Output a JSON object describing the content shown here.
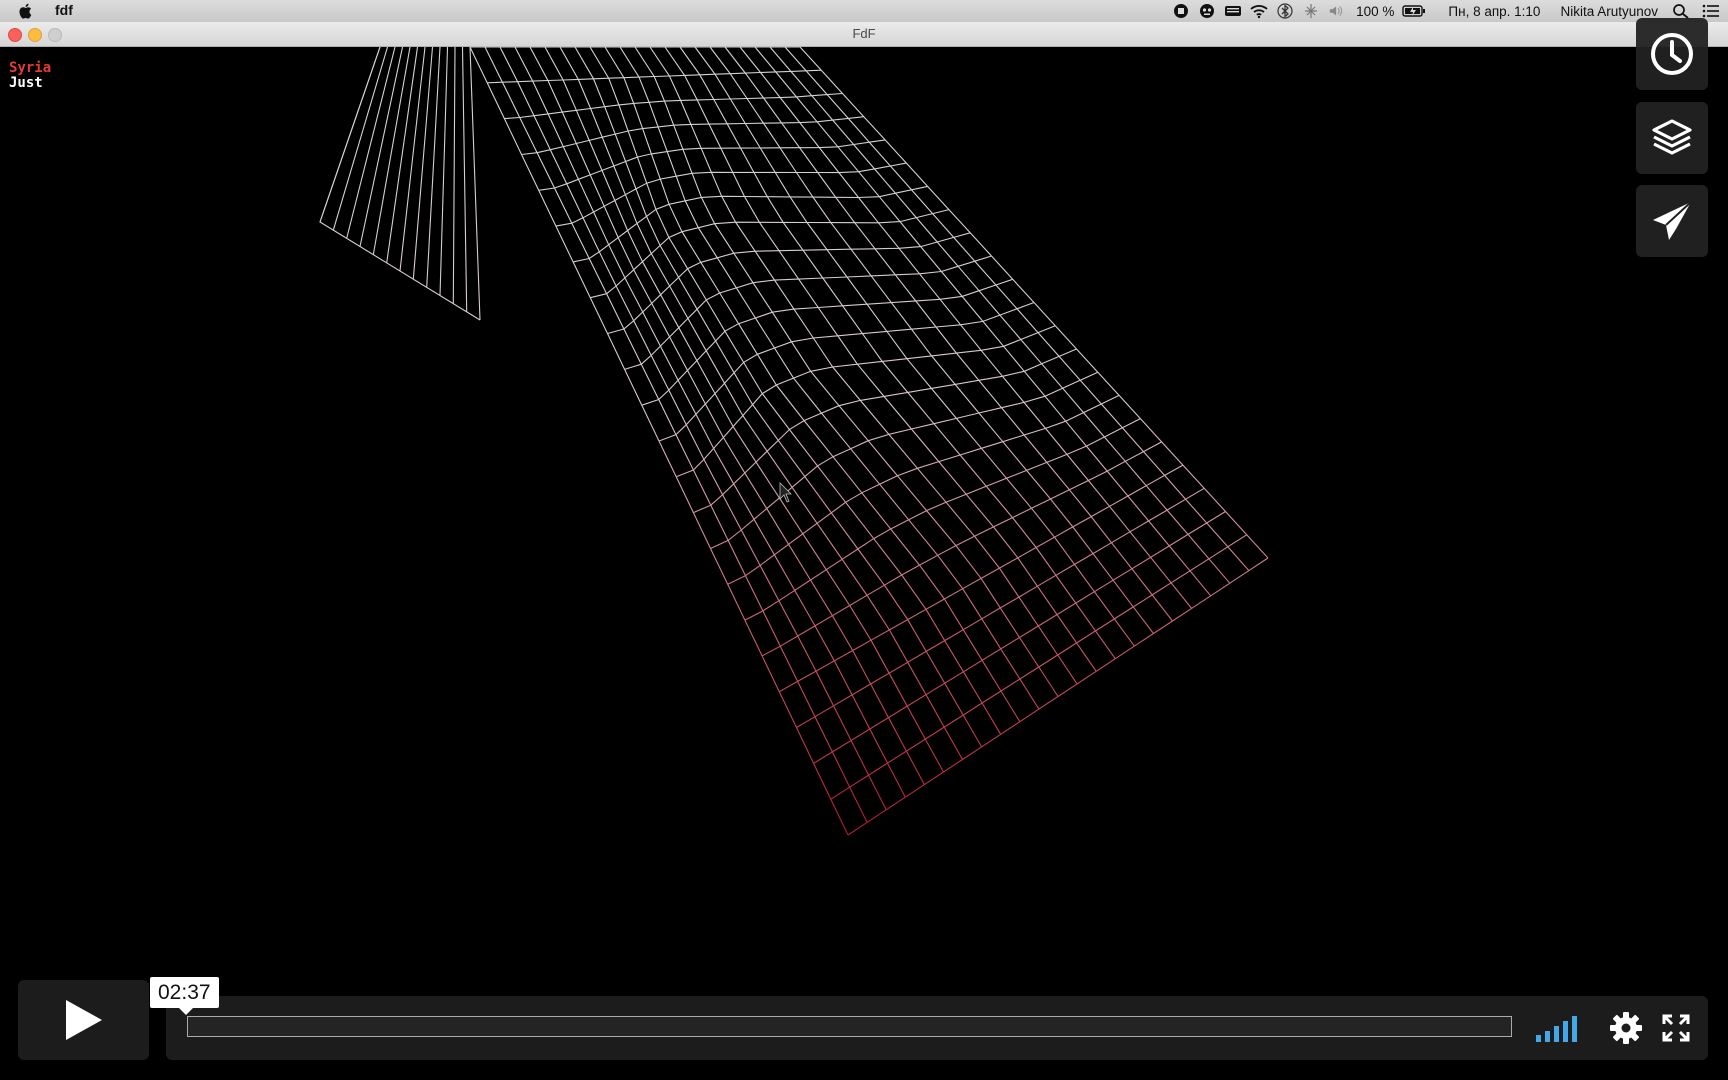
{
  "menubar": {
    "app_name": "fdf",
    "battery": "100 %",
    "datetime": "Пн, 8 апр.  1:10",
    "user": "Nikita Arutyunov"
  },
  "window": {
    "title": "FdF"
  },
  "overlay": {
    "line1": "Syria",
    "line2": "Just"
  },
  "player": {
    "time_tooltip": "02:37"
  },
  "colors": {
    "mesh_top": "#d0d0d0",
    "mesh_bottom": "#c0283a",
    "overlay_red": "#e33a3a"
  },
  "icons": [
    "apple-icon",
    "record-icon",
    "monkey-icon",
    "keyboard-icon",
    "wifi-icon",
    "bluetooth-icon",
    "volume-icon",
    "battery-icon",
    "search-icon",
    "list-icon",
    "clock-icon",
    "layers-icon",
    "paper-plane-icon",
    "play-icon",
    "volume-bars-icon",
    "gear-icon",
    "fullscreen-icon"
  ]
}
